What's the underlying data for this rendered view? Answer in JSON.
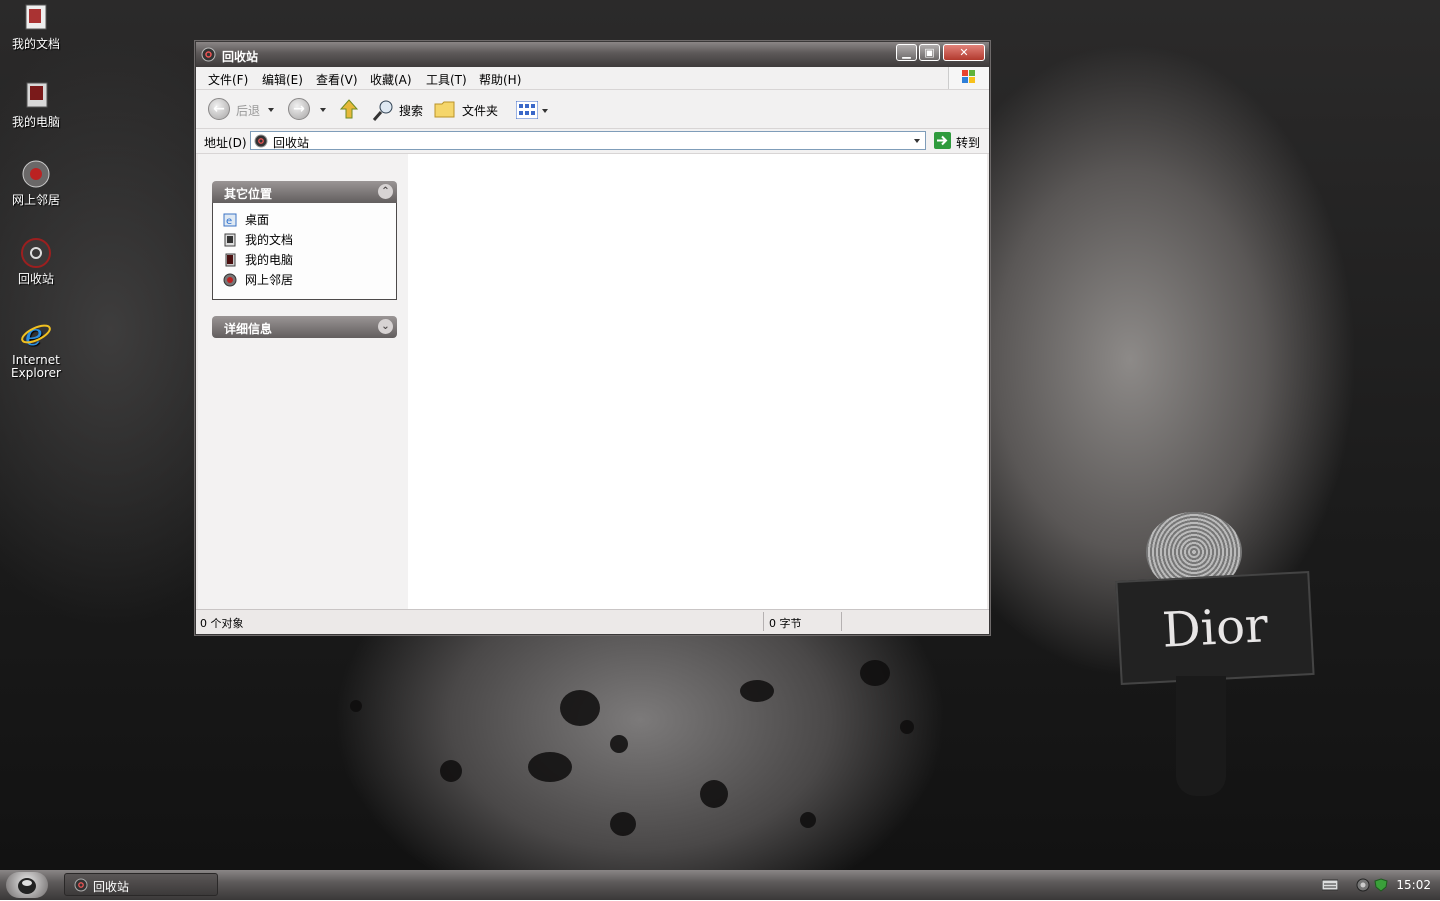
{
  "desktop": {
    "icons": [
      {
        "label": "我的文档"
      },
      {
        "label": "我的电脑"
      },
      {
        "label": "网上邻居"
      },
      {
        "label": "回收站"
      },
      {
        "label": "Internet Explorer"
      }
    ],
    "wallpaper_text": "Dior"
  },
  "window": {
    "title": "回收站",
    "menus": [
      "文件(F)",
      "编辑(E)",
      "查看(V)",
      "收藏(A)",
      "工具(T)",
      "帮助(H)"
    ],
    "toolbar": {
      "back": "后退",
      "search": "搜索",
      "folders": "文件夹"
    },
    "address": {
      "label": "地址(D)",
      "value": "回收站",
      "go": "转到"
    },
    "other_places": {
      "title": "其它位置",
      "items": [
        "桌面",
        "我的文档",
        "我的电脑",
        "网上邻居"
      ]
    },
    "details": {
      "title": "详细信息"
    },
    "status": {
      "objects": "0 个对象",
      "bytes": "0 字节"
    }
  },
  "taskbar": {
    "task_label": "回收站",
    "clock": "15:02"
  }
}
